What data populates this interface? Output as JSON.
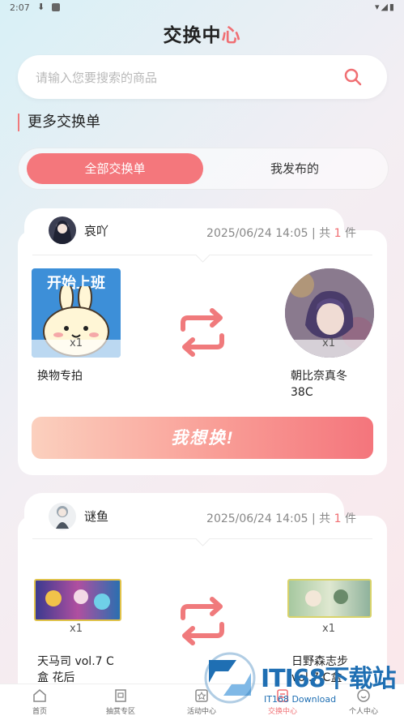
{
  "status_bar": {
    "time": "2:07",
    "right_icons": "wifi-signal-battery"
  },
  "header": {
    "title_part1": "交换中",
    "title_part2": "心"
  },
  "search": {
    "placeholder": "请输入您要搜索的商品",
    "value": ""
  },
  "section": {
    "title": "更多交换单"
  },
  "tabs": [
    {
      "label": "全部交换单",
      "active": true
    },
    {
      "label": "我发布的",
      "active": false
    }
  ],
  "cards": [
    {
      "username": "哀吖",
      "datetime": "2025/06/24 14:05",
      "sep": " | 共 ",
      "count": "1",
      "unit": " 件",
      "left_item": {
        "name": "换物专拍",
        "qty": "x1",
        "image_caption": "开始上班"
      },
      "right_item": {
        "name": "朝比奈真冬 38C",
        "qty": "x1"
      },
      "button": "我想换!"
    },
    {
      "username": "谜鱼",
      "datetime": "2025/06/24 14:05",
      "sep": " | 共 ",
      "count": "1",
      "unit": " 件",
      "left_item": {
        "name": "天马司 vol.7 C盒 花后",
        "qty": "x1"
      },
      "right_item": {
        "name": "日野森志步 vol.7 C盒",
        "qty": "x1"
      }
    }
  ],
  "bottom_nav": [
    {
      "label": "首页",
      "icon": "home-icon"
    },
    {
      "label": "抽赏专区",
      "icon": "ticket-icon"
    },
    {
      "label": "活动中心",
      "icon": "star-icon"
    },
    {
      "label": "交换中心",
      "icon": "exchange-icon",
      "active": true
    },
    {
      "label": "个人中心",
      "icon": "profile-icon"
    }
  ],
  "watermark": {
    "text": "ITI68下载站",
    "sub": "IT168 Download"
  },
  "colors": {
    "accent": "#f4777c",
    "swap_arrows": "#f07a7c",
    "watermark": "#1f6fb3"
  }
}
